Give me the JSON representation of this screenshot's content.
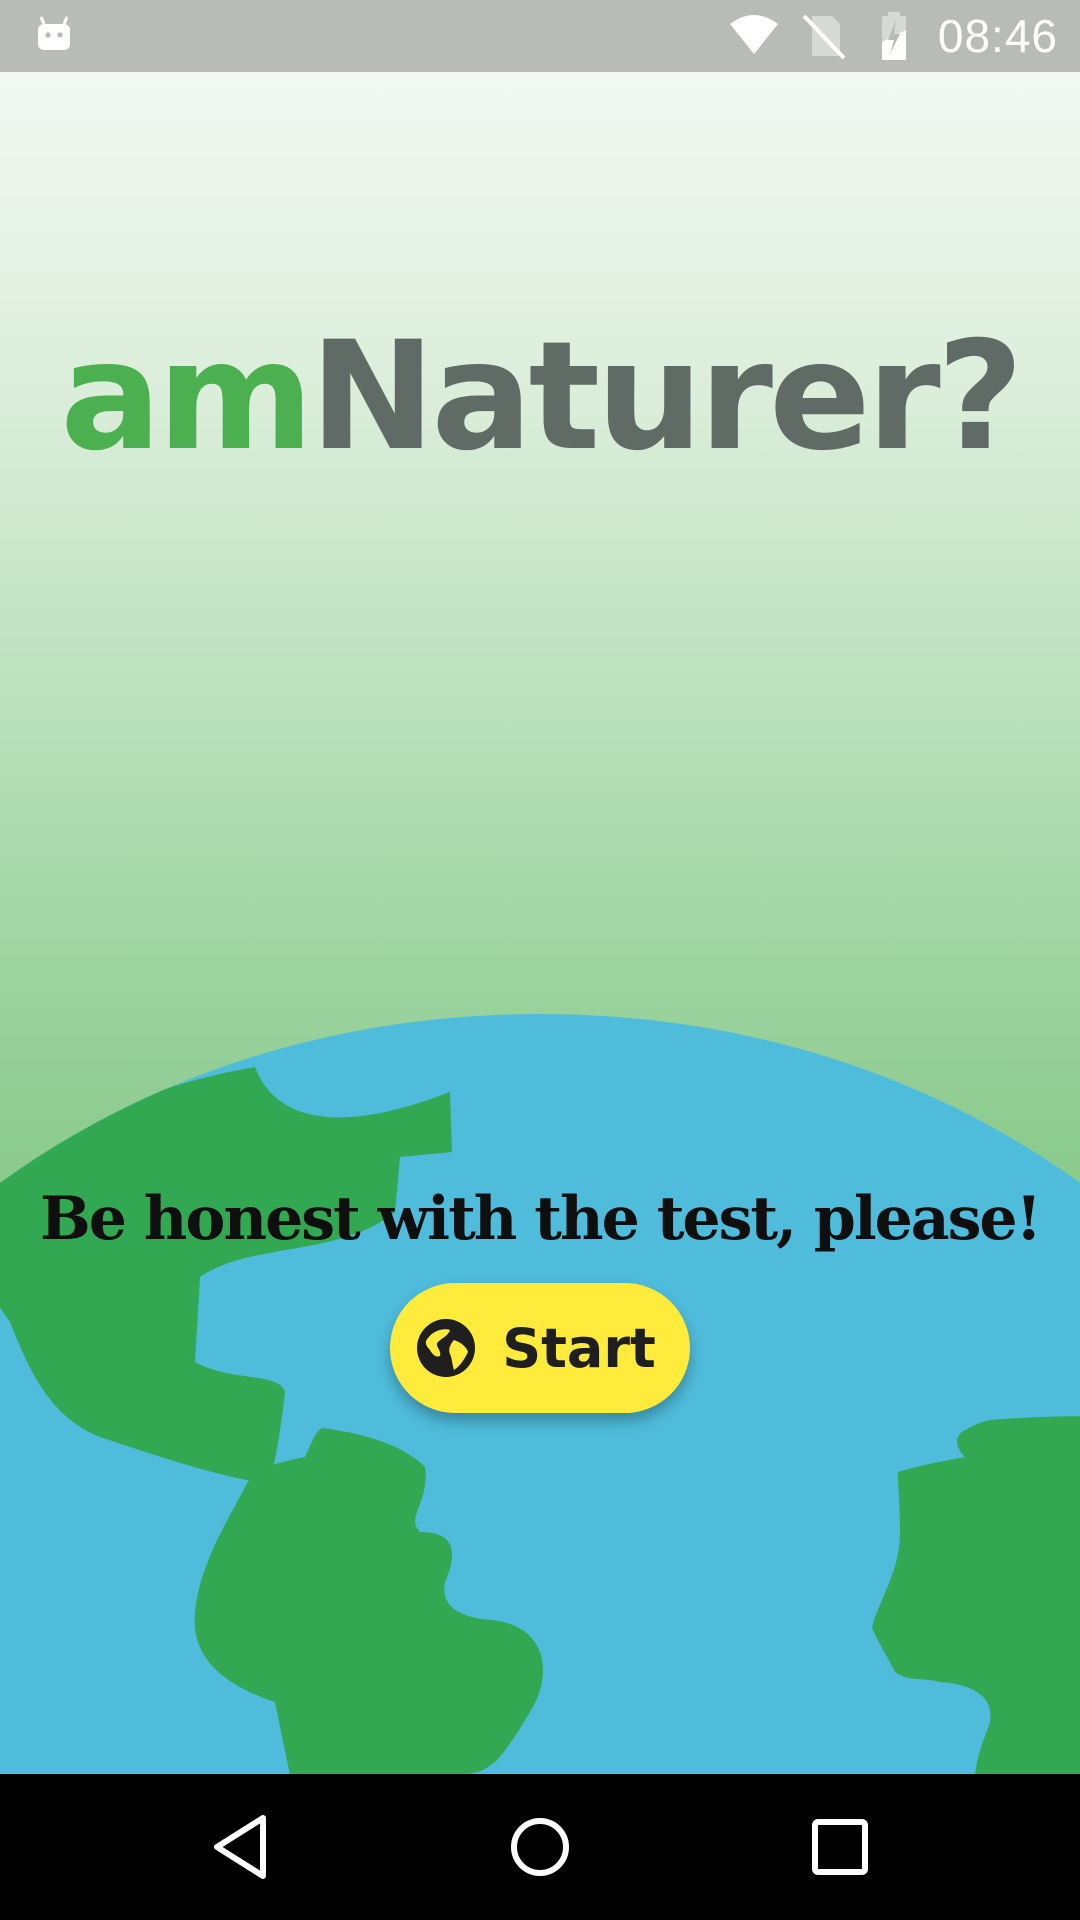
{
  "status_bar": {
    "time": "08:46",
    "left_icon": "android-icon",
    "right_icons": [
      "wifi-icon",
      "no-sim-icon",
      "battery-charging-icon"
    ]
  },
  "app": {
    "title_part_1": "am",
    "title_part_2": "Naturer?",
    "tagline": "Be honest with the test, please!",
    "start_button": {
      "label": "Start",
      "icon": "globe-icon"
    }
  },
  "nav_bar": {
    "buttons": [
      "back-icon",
      "home-icon",
      "recents-icon"
    ]
  },
  "colors": {
    "status_bar": "#b9bbb9",
    "title_accent": "#4caf50",
    "title_main": "#5f6b64",
    "ocean": "#4fbcdc",
    "land": "#32a852",
    "button": "#ffeb3b",
    "nav_bar": "#000000"
  }
}
